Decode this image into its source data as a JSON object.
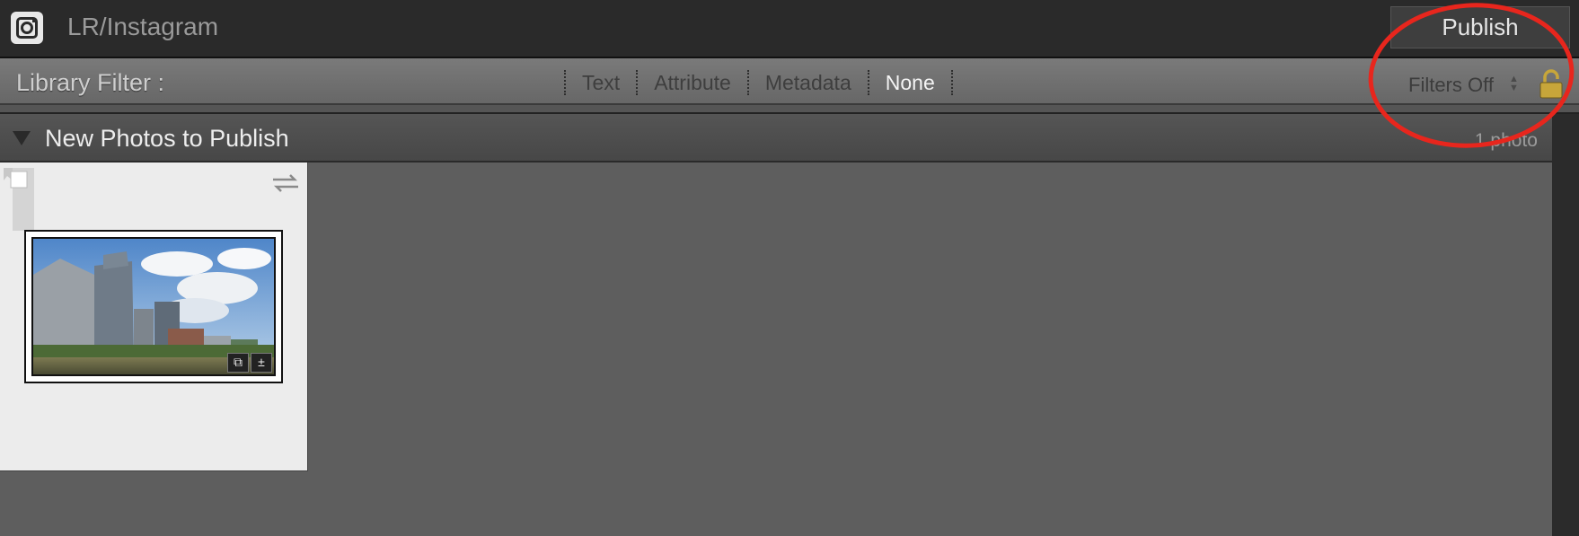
{
  "titlebar": {
    "title": "LR/Instagram",
    "publish_label": "Publish"
  },
  "filter": {
    "label": "Library Filter :",
    "tabs": [
      {
        "label": "Text",
        "active": false
      },
      {
        "label": "Attribute",
        "active": false
      },
      {
        "label": "Metadata",
        "active": false
      },
      {
        "label": "None",
        "active": true
      }
    ],
    "preset": "Filters Off"
  },
  "section": {
    "title": "New Photos to Publish",
    "count": "1 photo"
  },
  "icons": {
    "app": "instagram-icon",
    "lock": "lock-icon",
    "collapse": "triangle-down-icon",
    "flag": "flag-icon",
    "sync": "sync-arrows-icon",
    "badges": [
      "copies-icon",
      "plus-minus-icon"
    ]
  },
  "colors": {
    "annotation": "#e8261d",
    "lock": "#c7a63a"
  }
}
